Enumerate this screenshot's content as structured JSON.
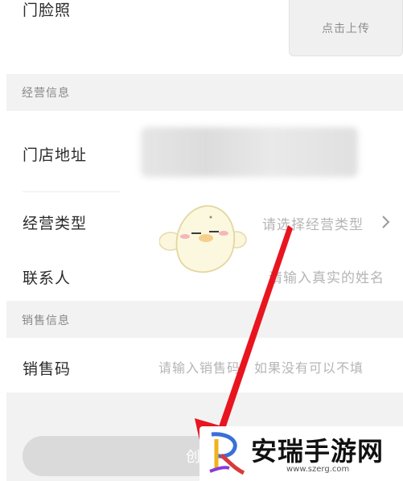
{
  "storefront": {
    "label": "门脸照",
    "upload_label": "点击上传"
  },
  "business_section": {
    "title": "经营信息"
  },
  "address": {
    "label": "门店地址"
  },
  "business_type": {
    "label": "经营类型",
    "placeholder": "请选择经营类型"
  },
  "contact": {
    "label": "联系人",
    "placeholder": "请输入真实的姓名"
  },
  "sales_section": {
    "title": "销售信息"
  },
  "sales_code": {
    "label": "销售码",
    "placeholder": "请输入销售码，如果没有可以不填"
  },
  "submit": {
    "label": "创建"
  },
  "watermark": {
    "title": "安瑞手游网",
    "url": "www.szerg.com"
  },
  "colors": {
    "arrow": "#e8151f",
    "section_bg": "#f2f2f2",
    "button_bg": "#dadada"
  }
}
